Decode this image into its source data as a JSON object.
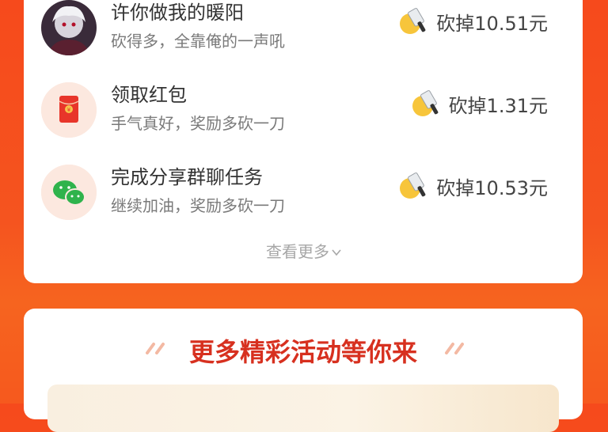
{
  "records": [
    {
      "name": "许你做我的暖阳",
      "desc": "砍得多，全靠俺的一声吼",
      "amount": "砍掉10.51元",
      "avatar": "user-avatar"
    },
    {
      "name": "领取红包",
      "desc": "手气真好，奖励多砍一刀",
      "amount": "砍掉1.31元",
      "avatar": "red-envelope-icon"
    },
    {
      "name": "完成分享群聊任务",
      "desc": "继续加油，奖励多砍一刀",
      "amount": "砍掉10.53元",
      "avatar": "wechat-icon"
    }
  ],
  "view_more": "查看更多",
  "promo": {
    "title": "更多精彩活动等你来"
  },
  "colors": {
    "accent": "#f64a1c",
    "promo_title": "#d7301f"
  }
}
